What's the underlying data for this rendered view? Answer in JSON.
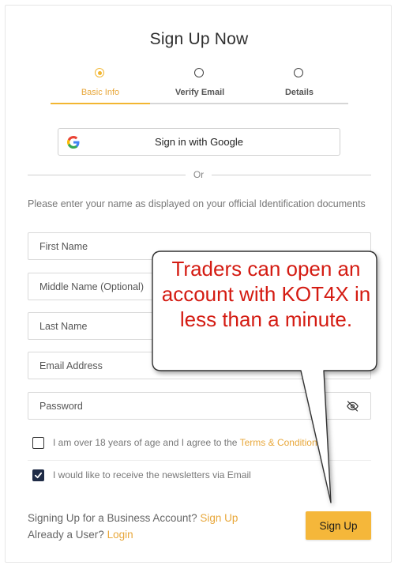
{
  "signup": {
    "title": "Sign Up Now",
    "steps": [
      {
        "label": "Basic Info"
      },
      {
        "label": "Verify Email"
      },
      {
        "label": "Details"
      }
    ],
    "google_button_label": "Sign in with Google",
    "divider_text": "Or",
    "instruction": "Please enter your name as displayed on your official Identification documents",
    "fields": {
      "first_name_placeholder": "First Name",
      "middle_name_placeholder": "Middle Name (Optional)",
      "last_name_placeholder": "Last Name",
      "email_placeholder": "Email Address",
      "password_placeholder": "Password"
    },
    "age_terms": {
      "text": "I am over 18 years of age and I agree to the",
      "link": "Terms & Conditions*",
      "checked": false
    },
    "newsletter": {
      "text": "I would like to receive the newsletters via Email",
      "checked": true
    },
    "business_prompt": "Signing Up for a Business Account?",
    "business_link": "Sign Up",
    "existing_prompt": "Already a User?",
    "login_link": "Login",
    "submit_label": "Sign Up"
  },
  "annotation": {
    "text": "Traders can open an account with KOT4X in less than a minute."
  },
  "colors": {
    "accent": "#f2b631",
    "annotation_text": "#d41b12",
    "checkbox_checked": "#1f2b46"
  },
  "icons": {
    "google": "google-g-icon",
    "password_toggle": "eye-slash-icon",
    "checkmark": "checkmark-icon"
  }
}
